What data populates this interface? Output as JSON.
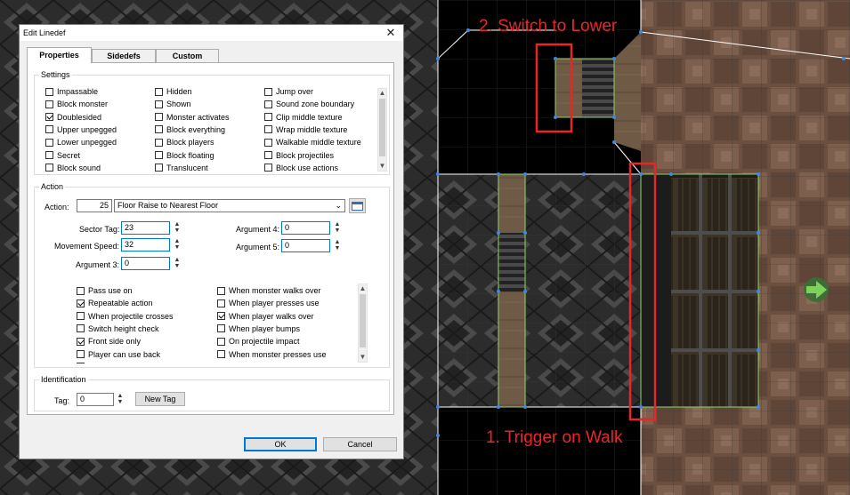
{
  "annotations": {
    "switch_label": "2. Switch to Lower",
    "trigger_label": "1. Trigger on Walk"
  },
  "colors": {
    "annotation_red": "#e8262a",
    "highlight_blue": "#0078d7",
    "vertex_blue": "#3c8be0"
  },
  "dialog": {
    "title": "Edit Linedef",
    "close_icon": "close-icon",
    "tabs": [
      {
        "label": "Properties",
        "active": true
      },
      {
        "label": "Sidedefs",
        "active": false
      },
      {
        "label": "Custom",
        "active": false
      }
    ],
    "settings": {
      "title": "Settings",
      "flags": [
        {
          "label": "Impassable",
          "checked": false
        },
        {
          "label": "Block monster",
          "checked": false
        },
        {
          "label": "Doublesided",
          "checked": true
        },
        {
          "label": "Upper unpegged",
          "checked": false
        },
        {
          "label": "Lower unpegged",
          "checked": false
        },
        {
          "label": "Secret",
          "checked": false
        },
        {
          "label": "Block sound",
          "checked": false
        },
        {
          "label": "Hidden",
          "checked": false
        },
        {
          "label": "Shown",
          "checked": false
        },
        {
          "label": "Monster activates",
          "checked": false
        },
        {
          "label": "Block everything",
          "checked": false
        },
        {
          "label": "Block players",
          "checked": false
        },
        {
          "label": "Block floating",
          "checked": false
        },
        {
          "label": "Translucent",
          "checked": false
        },
        {
          "label": "Jump over",
          "checked": false
        },
        {
          "label": "Sound zone boundary",
          "checked": false
        },
        {
          "label": "Clip middle texture",
          "checked": false
        },
        {
          "label": "Wrap middle texture",
          "checked": false
        },
        {
          "label": "Walkable middle texture",
          "checked": false
        },
        {
          "label": "Block projectiles",
          "checked": false
        },
        {
          "label": "Block use actions",
          "checked": false
        }
      ]
    },
    "action": {
      "title": "Action",
      "action_label": "Action:",
      "action_number": "25",
      "action_name": "Floor Raise to Nearest Floor",
      "sector_tag_label": "Sector Tag:",
      "sector_tag_value": "23",
      "movement_speed_label": "Movement Speed:",
      "movement_speed_value": "32",
      "argument3_label": "Argument 3:",
      "argument3_value": "0",
      "argument4_label": "Argument 4:",
      "argument4_value": "0",
      "argument5_label": "Argument 5:",
      "argument5_value": "0",
      "activations": [
        {
          "label": "Pass use on",
          "checked": false
        },
        {
          "label": "Repeatable action",
          "checked": true
        },
        {
          "label": "When projectile crosses",
          "checked": false
        },
        {
          "label": "Switch height check",
          "checked": false
        },
        {
          "label": "Front side only",
          "checked": true
        },
        {
          "label": "Player can use back",
          "checked": false
        },
        {
          "label": "When monsters bumps",
          "checked": false
        },
        {
          "label": "When monster walks over",
          "checked": false
        },
        {
          "label": "When player presses use",
          "checked": false
        },
        {
          "label": "When player walks over",
          "checked": true
        },
        {
          "label": "When player bumps",
          "checked": false
        },
        {
          "label": "On projectile impact",
          "checked": false
        },
        {
          "label": "When monster presses use",
          "checked": false
        }
      ]
    },
    "identification": {
      "title": "Identification",
      "tag_label": "Tag:",
      "tag_value": "0",
      "new_tag_label": "New Tag"
    },
    "ok_label": "OK",
    "cancel_label": "Cancel"
  }
}
